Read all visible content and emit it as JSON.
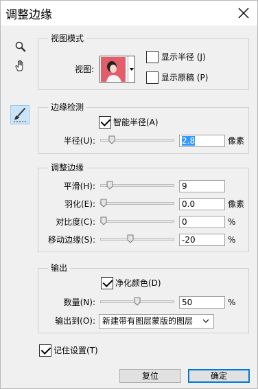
{
  "window": {
    "title": "调整边缘"
  },
  "tools": [
    "zoom-tool",
    "hand-tool",
    "refine-radius-tool"
  ],
  "view_mode": {
    "legend": "视图模式",
    "view_label": "视图:",
    "show_radius_label": "显示半径 (J)",
    "show_radius_checked": false,
    "show_original_label": "显示原稿 (P)",
    "show_original_checked": false
  },
  "edge_detection": {
    "legend": "边缘检测",
    "smart_radius_label": "智能半径(A)",
    "smart_radius_checked": true,
    "radius_label": "半径(U):",
    "radius_value": "2.8",
    "radius_unit": "像素",
    "radius_slider": 0.12
  },
  "adjust_edge": {
    "legend": "调整边缘",
    "rows": [
      {
        "label": "平滑(H):",
        "value": "9",
        "unit": "",
        "slider": 0.09
      },
      {
        "label": "羽化(E):",
        "value": "0.0",
        "unit": "像素",
        "slider": 0.0
      },
      {
        "label": "对比度(C):",
        "value": "0",
        "unit": "%",
        "slider": 0.0
      },
      {
        "label": "移动边缘(S):",
        "value": "-20",
        "unit": "%",
        "slider": 0.4
      }
    ]
  },
  "output": {
    "legend": "输出",
    "decontaminate_label": "净化颜色(D)",
    "decontaminate_checked": true,
    "amount_label": "数量(N):",
    "amount_value": "50",
    "amount_unit": "%",
    "amount_slider": 0.5,
    "output_to_label": "输出到(O):",
    "output_to_value": "新建带有图层蒙版的图层"
  },
  "remember": {
    "label": "记住设置(T)",
    "checked": true
  },
  "buttons": {
    "reset": "复位",
    "ok": "确定"
  },
  "colors": {
    "accent": "#0078d7",
    "selection": "#3399ff"
  }
}
